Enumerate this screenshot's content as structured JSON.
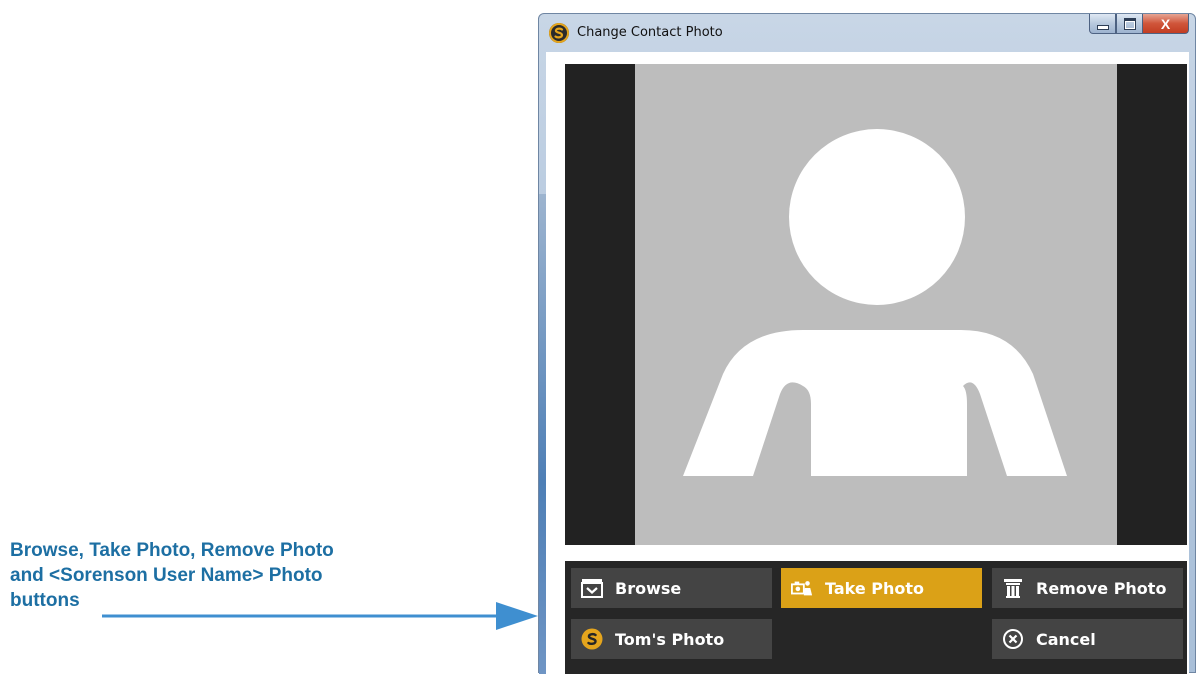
{
  "annotation": {
    "lines": [
      "Browse, Take Photo, Remove Photo",
      "and <Sorenson User Name> Photo",
      "buttons"
    ]
  },
  "window": {
    "title": "Change Contact Photo",
    "close_label": "X"
  },
  "buttons": {
    "browse": "Browse",
    "take_photo": "Take Photo",
    "remove_photo": "Remove Photo",
    "user_photo": "Tom's Photo",
    "cancel": "Cancel"
  },
  "colors": {
    "accent": "#dba117",
    "button_bg": "#444444",
    "panel_bg": "#262626",
    "annotation": "#1d6fa3",
    "placeholder_bg": "#bdbdbd"
  },
  "icons": {
    "browse": "folder-image-icon",
    "take_photo": "camera-person-icon",
    "remove_photo": "trash-icon",
    "user_photo": "sorenson-logo-icon",
    "cancel": "circle-x-icon"
  }
}
